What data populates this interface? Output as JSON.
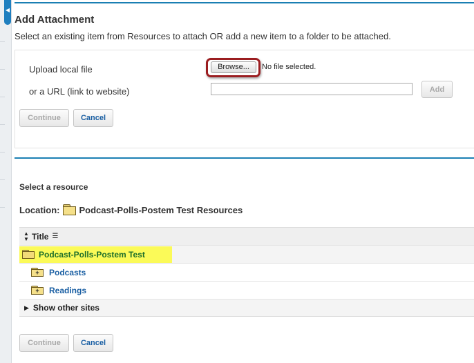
{
  "attachment": {
    "heading": "Add Attachment",
    "instructions": "Select an existing item from Resources to attach OR add a new item to a folder to be attached."
  },
  "upload": {
    "file_label": "Upload local file",
    "browse_label": "Browse...",
    "no_file_text": "No file selected.",
    "url_label": "or a URL (link to website)",
    "url_value": "",
    "add_label": "Add"
  },
  "actions_top": {
    "continue_label": "Continue",
    "cancel_label": "Cancel"
  },
  "resources": {
    "heading": "Select a resource",
    "location_label": "Location:",
    "location_name": "Podcast-Polls-Postem Test Resources",
    "column_title": "Title",
    "current_folder": "Podcast-Polls-Postem Test",
    "items": [
      {
        "label": "Podcasts",
        "icon": "folder-plus-icon"
      },
      {
        "label": "Readings",
        "icon": "folder-plus-icon"
      }
    ],
    "other_sites_label": "Show other sites"
  },
  "actions_bottom": {
    "continue_label": "Continue",
    "cancel_label": "Cancel"
  },
  "colors": {
    "accent_rule": "#1a7fb3",
    "highlight_yellow": "#fbfa58",
    "browse_highlight_border": "#9b1d20",
    "link_blue": "#1a5fa3",
    "current_folder_green": "#1c6e2a"
  }
}
